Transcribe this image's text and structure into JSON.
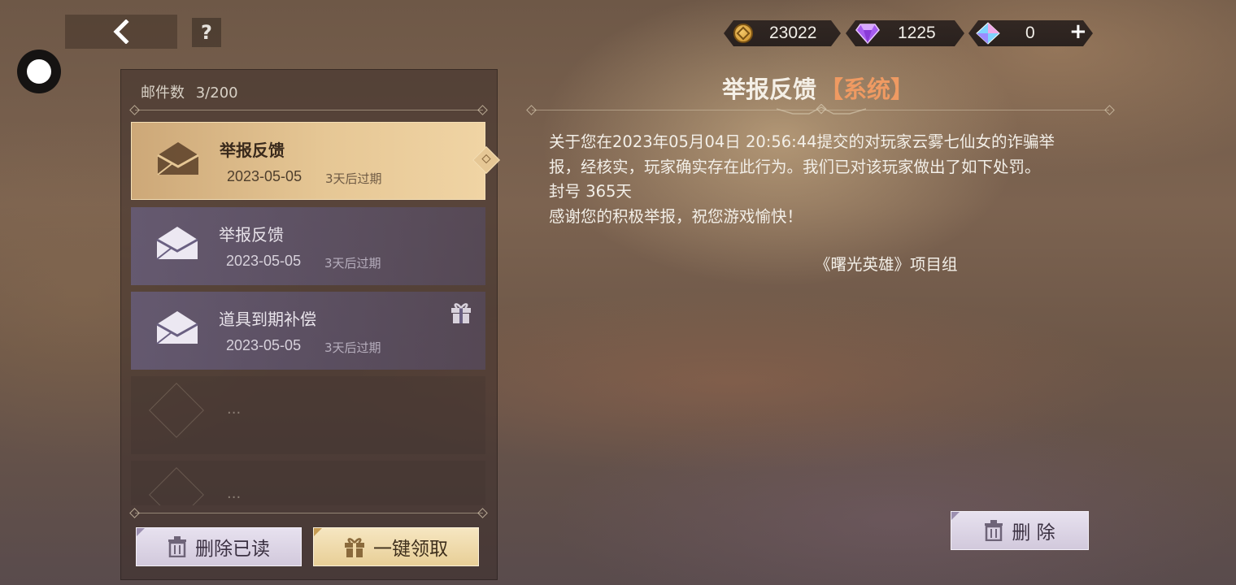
{
  "header": {
    "help_label": "?",
    "currencies": [
      {
        "name": "gold-coin",
        "icon": "coin-icon",
        "value": "23022"
      },
      {
        "name": "purple-diamond",
        "icon": "purple-gem-icon",
        "value": "1225"
      },
      {
        "name": "crystal",
        "icon": "crystal-icon",
        "value": "0"
      }
    ],
    "add_label": "+"
  },
  "mail_list": {
    "count_label": "邮件数",
    "count_value": "3/200",
    "items": [
      {
        "title": "举报反馈",
        "date": "2023-05-05",
        "expiry": "3天后过期",
        "selected": true,
        "has_gift": false
      },
      {
        "title": "举报反馈",
        "date": "2023-05-05",
        "expiry": "3天后过期",
        "selected": false,
        "has_gift": false
      },
      {
        "title": "道具到期补偿",
        "date": "2023-05-05",
        "expiry": "3天后过期",
        "selected": false,
        "has_gift": true
      }
    ],
    "empty_placeholder": "...",
    "delete_read_label": "删除已读",
    "claim_all_label": "一键领取"
  },
  "mail_detail": {
    "title": "举报反馈",
    "tag": "【系统】",
    "lines": [
      "关于您在2023年05月04日 20:56:44提交的对玩家云雾七仙女的诈骗举",
      "报，经核实，玩家确实存在此行为。我们已对该玩家做出了如下处罚。",
      "封号 365天",
      "感谢您的积极举报，祝您游戏愉快！"
    ],
    "signature": "《曙光英雄》项目组",
    "delete_label": "删 除"
  },
  "colors": {
    "selected_item": "#e6c795",
    "unselected_item": "#6a6082",
    "tag": "#ef9a62"
  }
}
